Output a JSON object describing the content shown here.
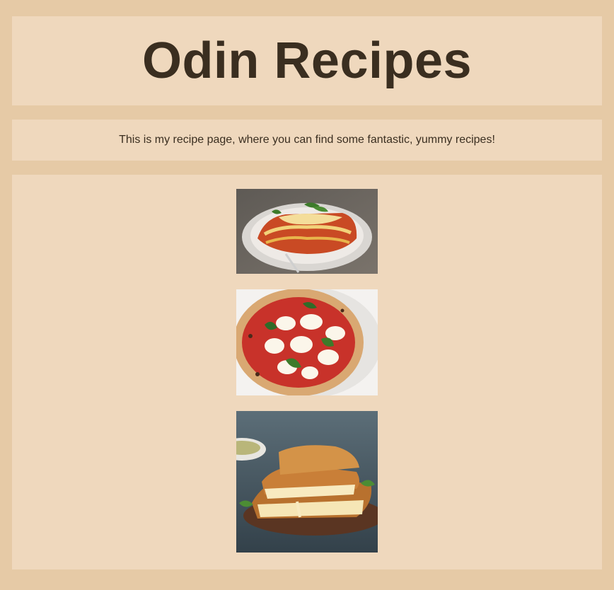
{
  "header": {
    "title": "Odin Recipes"
  },
  "intro": {
    "text": "This is my recipe page, where you can find some fantastic, yummy recipes!"
  },
  "gallery": {
    "images": [
      {
        "icon": "lasagna-photo"
      },
      {
        "icon": "pizza-photo"
      },
      {
        "icon": "grilled-cheese-photo"
      }
    ]
  },
  "colors": {
    "page_background": "#e6caa6",
    "panel_background": "#efd8bd",
    "text": "#3a2e20"
  }
}
